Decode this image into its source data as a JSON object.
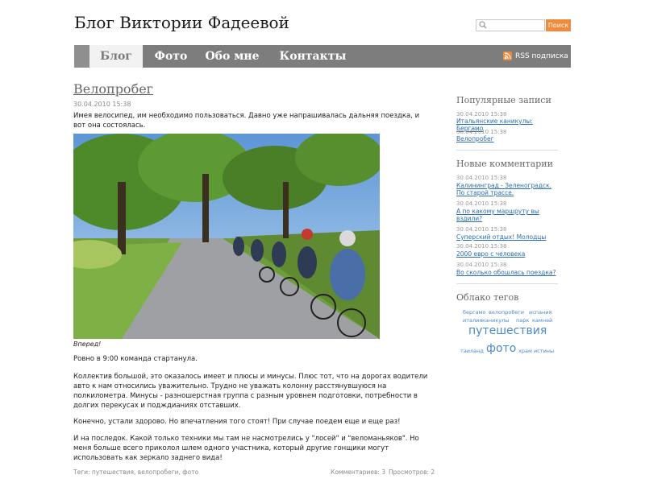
{
  "header": {
    "site_title": "Блог Виктории Фадеевой",
    "search_placeholder": "",
    "search_button": "Поиск"
  },
  "nav": {
    "items": [
      {
        "label": "Блог",
        "active": true
      },
      {
        "label": "Фото",
        "active": false
      },
      {
        "label": "Обо мне",
        "active": false
      },
      {
        "label": "Контакты",
        "active": false
      }
    ],
    "rss_label": "RSS подписка"
  },
  "post": {
    "title": "Велопробег",
    "date": "30.04.2010 15:38",
    "intro": "Имея велосипед, им необходимо пользоваться. Давно уже напрашивалась дальняя поездка, и вот она состоялась.",
    "caption": "Вперед!",
    "paragraphs": [
      "Ровно в 9:00 команда стартанула.",
      "Коллектив большой, это оказалось имеет и плюсы и минусы. Плюс тот, что на дорогах водители авто к нам относились уважительно. Трудно не уважать колонну расстянувшуюся на полкилометра. Минусы - разношерстная группа с разным уровнем подготовки, потребности в долгих перекусах и подждианиях отставших.",
      "Конечно, устали здорово. Но впечатления того стоят! При случае поедем еще и еще раз!",
      "И на последок. Какой только техники мы там не насмотрелись у \"лосей\" и \"веломаньяков\". Но меня больше всего приколол шлем одного участника, который другие гонщики могут использовать как зеркало заднего вида!"
    ],
    "tags_line": "Теги: путешествия, велопробеги, фото",
    "comments": "Комментариев: 3",
    "views": "Просмотров: 2"
  },
  "sidebar": {
    "popular": {
      "heading": "Популярные записи",
      "items": [
        {
          "date": "30.04.2010 15:38",
          "title": "Итальянские каникулы: Бергамо"
        },
        {
          "date": "30.04.2010 15:38",
          "title": "Велопробег"
        }
      ]
    },
    "comments": {
      "heading": "Новые комментарии",
      "items": [
        {
          "date": "30.04.2010 15:38",
          "title": "Калининград - Зеленоградск. По старой трассе."
        },
        {
          "date": "30.04.2010 15:38",
          "title": "А по какому маршруту вы вздили?"
        },
        {
          "date": "30.04.2010 15:38",
          "title": "Суперский отдых! Молодцы"
        },
        {
          "date": "30.04.2010 15:38",
          "title": "2000 евро с человека"
        },
        {
          "date": "30.04.2010 15:38",
          "title": "Во сколько обошлась поездка?"
        }
      ]
    },
    "tagcloud": {
      "heading": "Облако тегов",
      "tags": [
        "бергамо",
        "велопробеги",
        "испания",
        "италия",
        "каникулы",
        "парк",
        "камней",
        "путешествия",
        "таиланд",
        "фото",
        "храм",
        "истины"
      ]
    }
  },
  "colors": {
    "nav_bg": "#7d7d7d",
    "accent_orange": "#f08a3c",
    "link_blue": "#2a6db5",
    "tag_blue": "#4a8ac8"
  },
  "icons": {
    "search": "search-icon",
    "rss": "rss-icon"
  }
}
